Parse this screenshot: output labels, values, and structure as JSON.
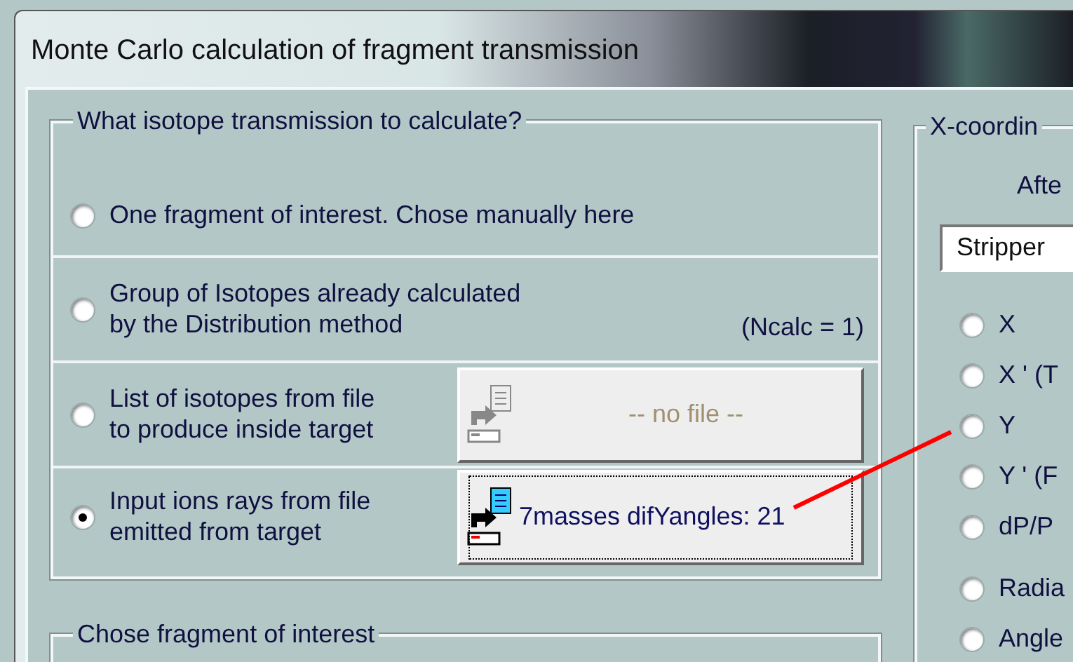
{
  "window": {
    "title": "Monte Carlo calculation of fragment transmission"
  },
  "isotope_group": {
    "legend": "What isotope transmission to calculate?",
    "options": [
      {
        "kind": "plain",
        "label": [
          "One fragment of interest. Chose manually here"
        ],
        "selected": false
      },
      {
        "kind": "note",
        "label": [
          "Group of Isotopes already calculated",
          "by the Distribution method"
        ],
        "note": "(Ncalc = 1)",
        "selected": false
      },
      {
        "kind": "file",
        "label": [
          "List of isotopes from file",
          "to produce inside target"
        ],
        "file_button": {
          "text": "-- no file --",
          "disabled": true
        },
        "selected": false
      },
      {
        "kind": "file",
        "label": [
          "Input ions rays from file",
          "emitted from target"
        ],
        "file_button": {
          "text": "7masses difYangles: 21",
          "disabled": false
        },
        "selected": true
      }
    ]
  },
  "fragment_group": {
    "legend": "Chose fragment of interest"
  },
  "x_group": {
    "legend": "X-coordin",
    "subtitle": "Afte",
    "dropdown": {
      "value": "Stripper"
    },
    "options": [
      {
        "label": "X",
        "selected": false
      },
      {
        "label": "X ' (T",
        "selected": false
      },
      {
        "label": "Y",
        "selected": false
      },
      {
        "label": "Y ' (F",
        "selected": false
      },
      {
        "label": "dP/P",
        "selected": false
      },
      {
        "label": "Radia",
        "selected": false,
        "gap": true
      },
      {
        "label": "Angle",
        "selected": false
      }
    ]
  }
}
